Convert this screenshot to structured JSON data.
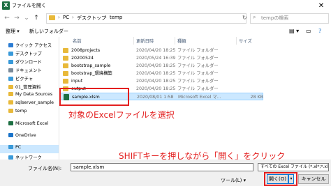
{
  "window": {
    "title": "ファイルを開く",
    "close_glyph": "✕"
  },
  "address": {
    "crumbs": [
      "PC",
      "デスクトップ",
      "temp"
    ],
    "separator": "›"
  },
  "search": {
    "placeholder": "tempの検索"
  },
  "toolbar": {
    "organize": "整理 ▾",
    "new_folder": "新しいフォルダー"
  },
  "sidebar": {
    "items": [
      {
        "label": "クイック アクセス",
        "icon": "star-icon",
        "color": "#2b7cd3"
      },
      {
        "label": "デスクトップ",
        "icon": "desktop-icon",
        "color": "#3a9ad9"
      },
      {
        "label": "ダウンロード",
        "icon": "download-icon",
        "color": "#3a9ad9"
      },
      {
        "label": "ドキュメント",
        "icon": "document-icon",
        "color": "#7a8a99"
      },
      {
        "label": "ピクチャ",
        "icon": "picture-icon",
        "color": "#3a9ad9"
      },
      {
        "label": "01_管理資料",
        "icon": "folder-icon",
        "color": "#e8b93a"
      },
      {
        "label": "My Data Sources",
        "icon": "folder-icon",
        "color": "#e8b93a"
      },
      {
        "label": "sqlserver_sample",
        "icon": "folder-icon",
        "color": "#e8b93a"
      },
      {
        "label": "temp",
        "icon": "folder-icon",
        "color": "#e8b93a"
      },
      {
        "label": "Microsoft Excel",
        "icon": "excel-icon",
        "color": "#1d6f42"
      },
      {
        "label": "OneDrive",
        "icon": "cloud-icon",
        "color": "#1a73c9"
      },
      {
        "label": "PC",
        "icon": "pc-icon",
        "color": "#3a9ad9"
      },
      {
        "label": "ネットワーク",
        "icon": "network-icon",
        "color": "#3a9ad9"
      }
    ]
  },
  "columns": {
    "name": "名前",
    "date": "更新日時",
    "type": "種類",
    "size": "サイズ"
  },
  "files": [
    {
      "name": "2008projects",
      "date": "2020/04/20 18:25",
      "type": "ファイル フォルダー",
      "size": "",
      "kind": "folder"
    },
    {
      "name": "20200524",
      "date": "2020/05/24 16:39",
      "type": "ファイル フォルダー",
      "size": "",
      "kind": "folder"
    },
    {
      "name": "bootstrap_sample",
      "date": "2020/04/20 18:25",
      "type": "ファイル フォルダー",
      "size": "",
      "kind": "folder"
    },
    {
      "name": "bootstrap_環境構築",
      "date": "2020/04/20 18:25",
      "type": "ファイル フォルダー",
      "size": "",
      "kind": "folder"
    },
    {
      "name": "input",
      "date": "2020/04/20 18:25",
      "type": "ファイル フォルダー",
      "size": "",
      "kind": "folder"
    },
    {
      "name": "output",
      "date": "2020/04/20 18:25",
      "type": "ファイル フォルダー",
      "size": "",
      "kind": "folder"
    },
    {
      "name": "sample.xlsm",
      "date": "2020/08/01 1:58",
      "type": "Microsoft Excel マ...",
      "size": "28 KB",
      "kind": "xlsm"
    }
  ],
  "annotations": {
    "select_file": "対象のExcelファイルを選択",
    "shift_open": "SHIFTキーを押しながら「開く」をクリック"
  },
  "bottom": {
    "filename_label": "ファイル名(N):",
    "filename_value": "sample.xlsm",
    "filetype_value": "すべての Excel ファイル (*.xl*;*.xlsx",
    "tools": "ツール(L) ▾",
    "open": "開く(O)",
    "open_dropdown": "▾",
    "cancel": "キャンセル"
  },
  "colors": {
    "accent": "#0078d7",
    "annotation": "#e32020",
    "selection": "#cce8ff"
  }
}
